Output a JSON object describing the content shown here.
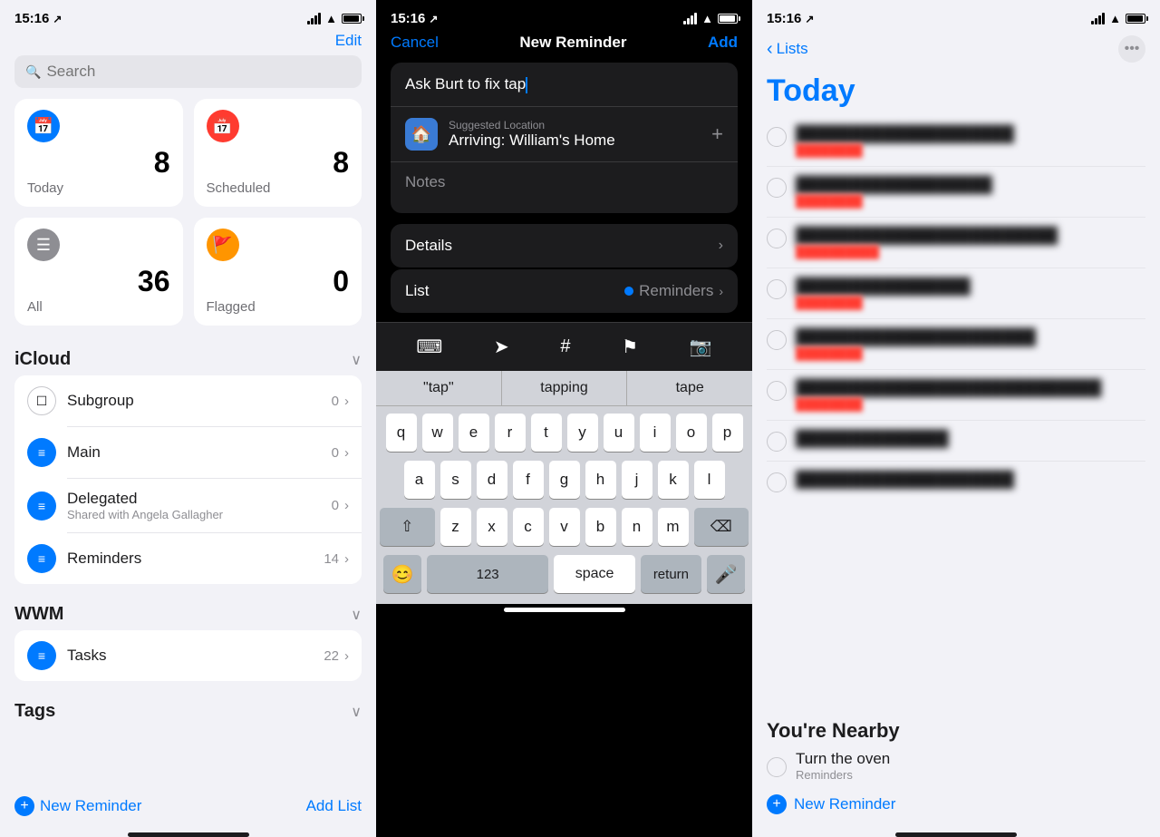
{
  "left": {
    "status": {
      "time": "15:16",
      "location": "↗"
    },
    "edit_label": "Edit",
    "search_placeholder": "Search",
    "smart_lists": [
      {
        "id": "today",
        "icon": "calendar",
        "icon_color": "icon-blue",
        "count": "8",
        "label": "Today"
      },
      {
        "id": "scheduled",
        "icon": "calendar-clock",
        "icon_color": "icon-red",
        "count": "8",
        "label": "Scheduled"
      },
      {
        "id": "all",
        "icon": "tray",
        "icon_color": "icon-gray",
        "count": "36",
        "label": "All"
      },
      {
        "id": "flagged",
        "icon": "flag",
        "icon_color": "icon-orange",
        "count": "0",
        "label": "Flagged"
      }
    ],
    "icloud": {
      "title": "iCloud",
      "items": [
        {
          "id": "subgroup",
          "icon": "square",
          "name": "Subgroup",
          "count": "0",
          "has_sub": true
        },
        {
          "id": "main",
          "icon": "list",
          "name": "Main",
          "count": "0",
          "has_sub": false
        },
        {
          "id": "delegated",
          "icon": "list",
          "name": "Delegated",
          "sub": "Shared with Angela Gallagher",
          "count": "0",
          "has_sub": false
        },
        {
          "id": "reminders",
          "icon": "list",
          "name": "Reminders",
          "count": "14",
          "has_sub": false
        }
      ]
    },
    "wwm": {
      "title": "WWM",
      "items": [
        {
          "id": "tasks",
          "icon": "list",
          "name": "Tasks",
          "count": "22",
          "has_sub": false
        }
      ]
    },
    "tags": {
      "title": "Tags"
    },
    "new_reminder_label": "New Reminder",
    "add_list_label": "Add List"
  },
  "middle": {
    "status": {
      "time": "15:16",
      "location": "↗"
    },
    "cancel_label": "Cancel",
    "title": "New Reminder",
    "add_label": "Add",
    "input_value": "Ask Burt to fix tap",
    "location_label": "Suggested Location",
    "location_value": "Arriving: William's Home",
    "notes_placeholder": "Notes",
    "details_label": "Details",
    "list_label": "List",
    "list_value": "Reminders",
    "toolbar_icons": [
      "grid",
      "location-arrow",
      "hashtag",
      "flag",
      "camera"
    ],
    "autocomplete": [
      {
        "label": "\"tap\"",
        "type": "quoted"
      },
      {
        "label": "tapping",
        "type": "normal"
      },
      {
        "label": "tape",
        "type": "normal"
      }
    ],
    "keyboard_rows": [
      [
        "q",
        "w",
        "e",
        "r",
        "t",
        "y",
        "u",
        "i",
        "o",
        "p"
      ],
      [
        "a",
        "s",
        "d",
        "f",
        "g",
        "h",
        "j",
        "k",
        "l"
      ],
      [
        "z",
        "x",
        "c",
        "v",
        "b",
        "n",
        "m"
      ]
    ],
    "space_label": "space",
    "return_label": "return",
    "num_label": "123",
    "emoji_icon": "😊",
    "mic_icon": "🎤"
  },
  "right": {
    "status": {
      "time": "15:16",
      "location": "↗"
    },
    "back_label": "Lists",
    "page_title": "Today",
    "items": [
      {
        "id": 1,
        "blurred": true
      },
      {
        "id": 2,
        "blurred": true
      },
      {
        "id": 3,
        "blurred": true
      },
      {
        "id": 4,
        "blurred": true
      },
      {
        "id": 5,
        "blurred": true
      },
      {
        "id": 6,
        "blurred": true
      },
      {
        "id": 7,
        "blurred": true
      },
      {
        "id": 8,
        "blurred": true
      }
    ],
    "nearby_title": "You're Nearby",
    "nearby_item": {
      "title": "Turn the oven",
      "sub": "Reminders"
    },
    "new_reminder_label": "New Reminder"
  }
}
